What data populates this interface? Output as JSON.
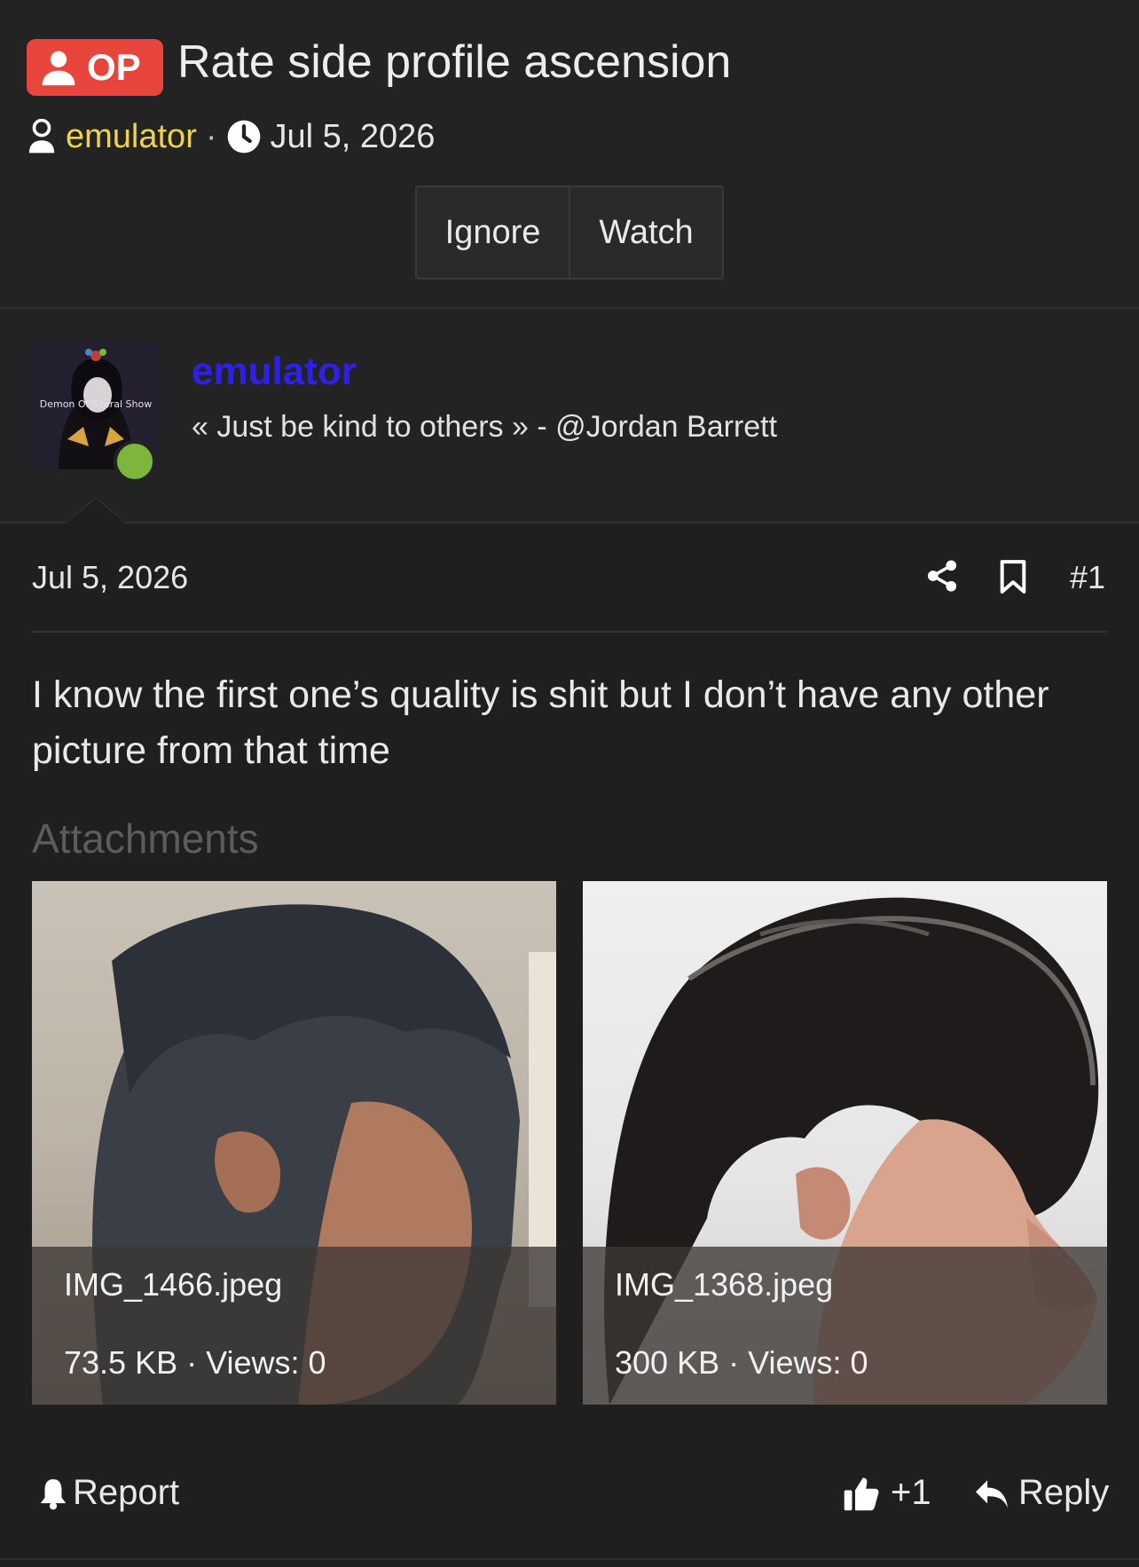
{
  "thread": {
    "op_badge": "OP",
    "title": "Rate side profile ascension",
    "author": "emulator",
    "separator": "·",
    "date": "Jul 5, 2026"
  },
  "actions": {
    "ignore": "Ignore",
    "watch": "Watch"
  },
  "user": {
    "username": "emulator",
    "signature": "« Just be kind to others » - @Jordan Barrett",
    "avatar_caption": "Demon Of Sceral Show",
    "online": true
  },
  "post": {
    "date": "Jul 5, 2026",
    "number": "#1",
    "body": "I know the first one’s quality is shit but I don’t have any other picture from that time",
    "attachments_label": "Attachments",
    "attachments": [
      {
        "filename": "IMG_1466.jpeg",
        "info": "73.5 KB · Views: 0"
      },
      {
        "filename": "IMG_1368.jpeg",
        "info": "300 KB · Views: 0"
      }
    ]
  },
  "footer": {
    "report": "Report",
    "like": "+1",
    "reply": "Reply"
  },
  "colors": {
    "op_badge": "#e8453c",
    "author": "#f0d24a",
    "username": "#2e21e6",
    "online": "#7db63a"
  }
}
